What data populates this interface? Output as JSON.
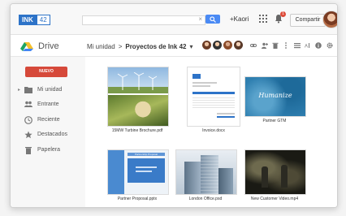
{
  "header": {
    "logo_main": "INK",
    "logo_num": "42",
    "search_clear": "×",
    "user_label": "+Kaori",
    "notification_count": "1",
    "share_label": "Compartir"
  },
  "toolbar": {
    "app_name": "Drive",
    "breadcrumb_root": "Mi unidad",
    "breadcrumb_sep": ">",
    "breadcrumb_current": "Proyectos de Ink 42",
    "breadcrumb_caret": "▾"
  },
  "sidebar": {
    "new_label": "NUEVO",
    "items": [
      {
        "label": "Mi unidad",
        "icon": "folder-icon"
      },
      {
        "label": "Entrante",
        "icon": "people-icon"
      },
      {
        "label": "Reciente",
        "icon": "clock-icon"
      },
      {
        "label": "Destacados",
        "icon": "star-icon"
      },
      {
        "label": "Papelera",
        "icon": "trash-icon"
      }
    ]
  },
  "files": [
    {
      "name": "15MW Turbine Brochure.pdf"
    },
    {
      "name": "Invoice.docx"
    },
    {
      "name": "Partner GTM",
      "thumb_text": "Humanize"
    },
    {
      "name": "Partner Proposal.pptx",
      "thumb_text": "Partnership Proposal"
    },
    {
      "name": "London Office.psd"
    },
    {
      "name": "New Customer Video.mp4"
    }
  ],
  "colors": {
    "accent": "#4a8af4",
    "new_button": "#d6493a",
    "logo_blue": "#2d73c8"
  }
}
